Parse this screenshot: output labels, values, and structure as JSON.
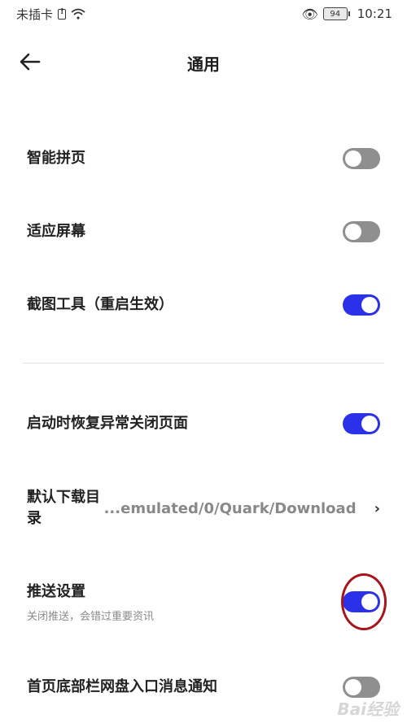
{
  "status_bar": {
    "carrier": "未插卡",
    "battery": "94",
    "time": "10:21"
  },
  "header": {
    "title": "通用"
  },
  "settings": [
    {
      "label": "智能拼页",
      "enabled": false
    },
    {
      "label": "适应屏幕",
      "enabled": false
    },
    {
      "label": "截图工具（重启生效）",
      "enabled": true
    },
    {
      "label": "启动时恢复异常关闭页面",
      "enabled": true
    },
    {
      "label_line1": "默认下载目",
      "label_line2": "录",
      "value": "...emulated/0/Quark/Download"
    },
    {
      "label": "推送设置",
      "sublabel": "关闭推送，会错过重要资讯",
      "enabled": true
    },
    {
      "label": "首页底部栏网盘入口消息通知",
      "enabled": false
    }
  ],
  "colors": {
    "toggle_on": "#2b31e8",
    "toggle_off": "#8f8f8f",
    "highlight_ring": "#a8141b"
  },
  "watermark": "Bai经验"
}
